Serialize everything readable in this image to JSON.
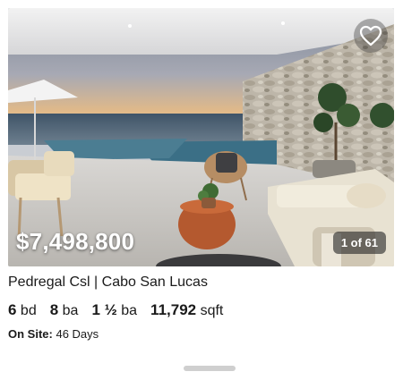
{
  "listing": {
    "price": "$7,498,800",
    "photo_counter": "1 of 61",
    "address": "Pedregal Csl | Cabo San Lucas",
    "beds_value": "6",
    "beds_unit": "bd",
    "baths_value": "8",
    "baths_unit": "ba",
    "half_baths_value": "1 ½",
    "half_baths_unit": "ba",
    "sqft_value": "11,792",
    "sqft_unit": "sqft",
    "on_site_label": "On Site:",
    "on_site_value": "46 Days"
  },
  "icons": {
    "favorite": "heart-outline-icon"
  },
  "colors": {
    "price_text": "#ffffff",
    "counter_bg": "#282828",
    "handle": "#cfcfcf"
  }
}
